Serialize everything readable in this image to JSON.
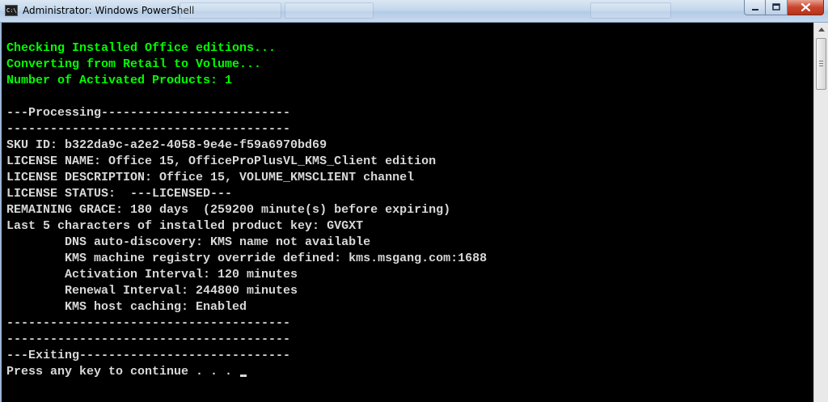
{
  "window": {
    "title": "Administrator: Windows PowerShell",
    "icon_text": "C:\\_"
  },
  "console": {
    "status_lines": [
      "Checking Installed Office editions...",
      "Converting from Retail to Volume...",
      "Number of Activated Products: 1"
    ],
    "output_lines": [
      "---Processing--------------------------",
      "---------------------------------------",
      "SKU ID: b322da9c-a2e2-4058-9e4e-f59a6970bd69",
      "LICENSE NAME: Office 15, OfficeProPlusVL_KMS_Client edition",
      "LICENSE DESCRIPTION: Office 15, VOLUME_KMSCLIENT channel",
      "LICENSE STATUS:  ---LICENSED---",
      "REMAINING GRACE: 180 days  (259200 minute(s) before expiring)",
      "Last 5 characters of installed product key: GVGXT",
      "        DNS auto-discovery: KMS name not available",
      "        KMS machine registry override defined: kms.msgang.com:1688",
      "        Activation Interval: 120 minutes",
      "        Renewal Interval: 244800 minutes",
      "        KMS host caching: Enabled",
      "---------------------------------------",
      "---------------------------------------",
      "---Exiting-----------------------------"
    ],
    "prompt": "Press any key to continue . . . "
  },
  "colors": {
    "status_text": "#00ff00",
    "output_text": "#d8d8d8",
    "background": "#000000"
  },
  "icons": {
    "app": "powershell-console-icon",
    "minimize": "minimize-icon",
    "maximize": "maximize-icon",
    "close": "close-icon",
    "scroll_up": "scroll-up-arrow-icon"
  }
}
